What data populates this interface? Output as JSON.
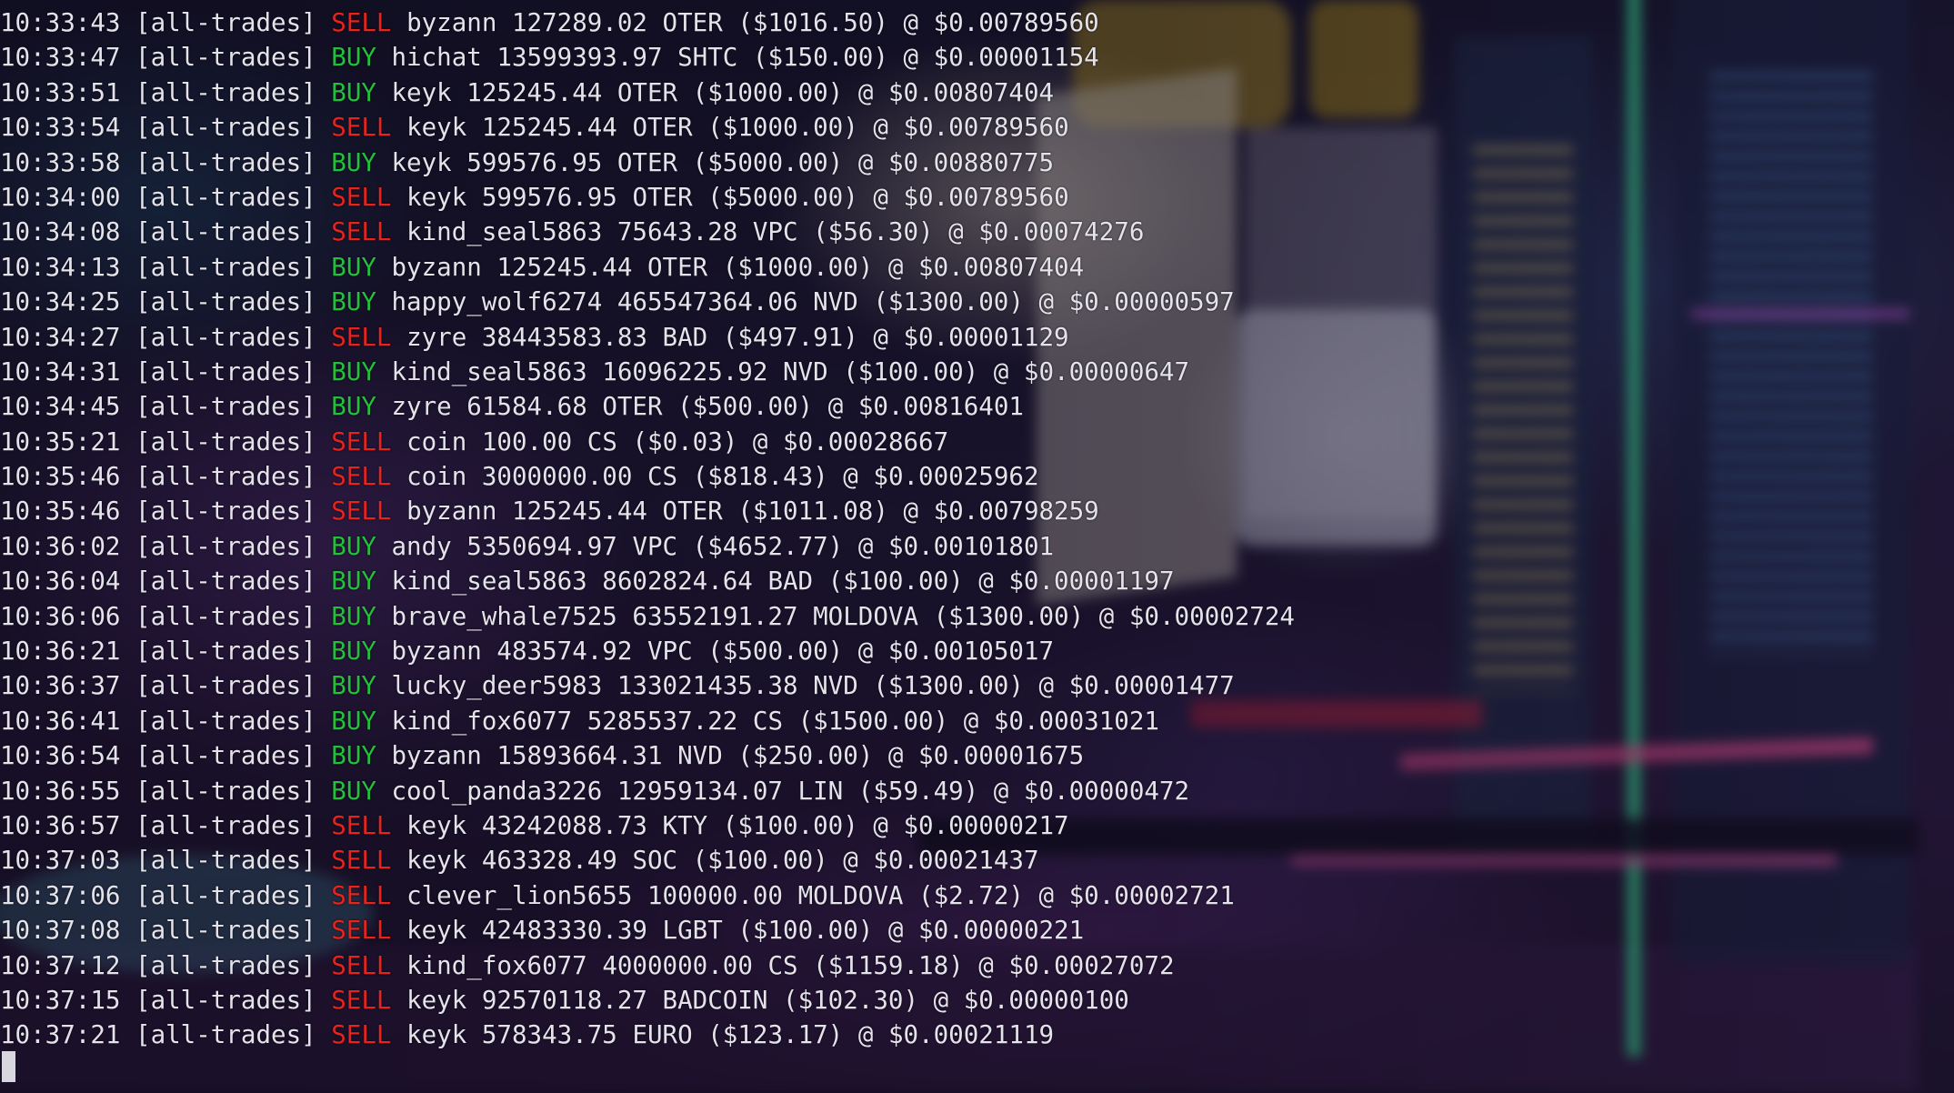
{
  "trades": [
    {
      "time": "10:33:43",
      "channel": "[all-trades]",
      "side": "SELL",
      "user": "byzann",
      "amount": "127289.02",
      "token": "OTER",
      "usd": "($1016.50)",
      "price": "$0.00789560"
    },
    {
      "time": "10:33:47",
      "channel": "[all-trades]",
      "side": "BUY",
      "user": "hichat",
      "amount": "13599393.97",
      "token": "SHTC",
      "usd": "($150.00)",
      "price": "$0.00001154"
    },
    {
      "time": "10:33:51",
      "channel": "[all-trades]",
      "side": "BUY",
      "user": "keyk",
      "amount": "125245.44",
      "token": "OTER",
      "usd": "($1000.00)",
      "price": "$0.00807404"
    },
    {
      "time": "10:33:54",
      "channel": "[all-trades]",
      "side": "SELL",
      "user": "keyk",
      "amount": "125245.44",
      "token": "OTER",
      "usd": "($1000.00)",
      "price": "$0.00789560"
    },
    {
      "time": "10:33:58",
      "channel": "[all-trades]",
      "side": "BUY",
      "user": "keyk",
      "amount": "599576.95",
      "token": "OTER",
      "usd": "($5000.00)",
      "price": "$0.00880775"
    },
    {
      "time": "10:34:00",
      "channel": "[all-trades]",
      "side": "SELL",
      "user": "keyk",
      "amount": "599576.95",
      "token": "OTER",
      "usd": "($5000.00)",
      "price": "$0.00789560"
    },
    {
      "time": "10:34:08",
      "channel": "[all-trades]",
      "side": "SELL",
      "user": "kind_seal5863",
      "amount": "75643.28",
      "token": "VPC",
      "usd": "($56.30)",
      "price": "$0.00074276"
    },
    {
      "time": "10:34:13",
      "channel": "[all-trades]",
      "side": "BUY",
      "user": "byzann",
      "amount": "125245.44",
      "token": "OTER",
      "usd": "($1000.00)",
      "price": "$0.00807404"
    },
    {
      "time": "10:34:25",
      "channel": "[all-trades]",
      "side": "BUY",
      "user": "happy_wolf6274",
      "amount": "465547364.06",
      "token": "NVD",
      "usd": "($1300.00)",
      "price": "$0.00000597"
    },
    {
      "time": "10:34:27",
      "channel": "[all-trades]",
      "side": "SELL",
      "user": "zyre",
      "amount": "38443583.83",
      "token": "BAD",
      "usd": "($497.91)",
      "price": "$0.00001129"
    },
    {
      "time": "10:34:31",
      "channel": "[all-trades]",
      "side": "BUY",
      "user": "kind_seal5863",
      "amount": "16096225.92",
      "token": "NVD",
      "usd": "($100.00)",
      "price": "$0.00000647"
    },
    {
      "time": "10:34:45",
      "channel": "[all-trades]",
      "side": "BUY",
      "user": "zyre",
      "amount": "61584.68",
      "token": "OTER",
      "usd": "($500.00)",
      "price": "$0.00816401"
    },
    {
      "time": "10:35:21",
      "channel": "[all-trades]",
      "side": "SELL",
      "user": "coin",
      "amount": "100.00",
      "token": "CS",
      "usd": "($0.03)",
      "price": "$0.00028667"
    },
    {
      "time": "10:35:46",
      "channel": "[all-trades]",
      "side": "SELL",
      "user": "coin",
      "amount": "3000000.00",
      "token": "CS",
      "usd": "($818.43)",
      "price": "$0.00025962"
    },
    {
      "time": "10:35:46",
      "channel": "[all-trades]",
      "side": "SELL",
      "user": "byzann",
      "amount": "125245.44",
      "token": "OTER",
      "usd": "($1011.08)",
      "price": "$0.00798259"
    },
    {
      "time": "10:36:02",
      "channel": "[all-trades]",
      "side": "BUY",
      "user": "andy",
      "amount": "5350694.97",
      "token": "VPC",
      "usd": "($4652.77)",
      "price": "$0.00101801"
    },
    {
      "time": "10:36:04",
      "channel": "[all-trades]",
      "side": "BUY",
      "user": "kind_seal5863",
      "amount": "8602824.64",
      "token": "BAD",
      "usd": "($100.00)",
      "price": "$0.00001197"
    },
    {
      "time": "10:36:06",
      "channel": "[all-trades]",
      "side": "BUY",
      "user": "brave_whale7525",
      "amount": "63552191.27",
      "token": "MOLDOVA",
      "usd": "($1300.00)",
      "price": "$0.00002724"
    },
    {
      "time": "10:36:21",
      "channel": "[all-trades]",
      "side": "BUY",
      "user": "byzann",
      "amount": "483574.92",
      "token": "VPC",
      "usd": "($500.00)",
      "price": "$0.00105017"
    },
    {
      "time": "10:36:37",
      "channel": "[all-trades]",
      "side": "BUY",
      "user": "lucky_deer5983",
      "amount": "133021435.38",
      "token": "NVD",
      "usd": "($1300.00)",
      "price": "$0.00001477"
    },
    {
      "time": "10:36:41",
      "channel": "[all-trades]",
      "side": "BUY",
      "user": "kind_fox6077",
      "amount": "5285537.22",
      "token": "CS",
      "usd": "($1500.00)",
      "price": "$0.00031021"
    },
    {
      "time": "10:36:54",
      "channel": "[all-trades]",
      "side": "BUY",
      "user": "byzann",
      "amount": "15893664.31",
      "token": "NVD",
      "usd": "($250.00)",
      "price": "$0.00001675"
    },
    {
      "time": "10:36:55",
      "channel": "[all-trades]",
      "side": "BUY",
      "user": "cool_panda3226",
      "amount": "12959134.07",
      "token": "LIN",
      "usd": "($59.49)",
      "price": "$0.00000472"
    },
    {
      "time": "10:36:57",
      "channel": "[all-trades]",
      "side": "SELL",
      "user": "keyk",
      "amount": "43242088.73",
      "token": "KTY",
      "usd": "($100.00)",
      "price": "$0.00000217"
    },
    {
      "time": "10:37:03",
      "channel": "[all-trades]",
      "side": "SELL",
      "user": "keyk",
      "amount": "463328.49",
      "token": "SOC",
      "usd": "($100.00)",
      "price": "$0.00021437"
    },
    {
      "time": "10:37:06",
      "channel": "[all-trades]",
      "side": "SELL",
      "user": "clever_lion5655",
      "amount": "100000.00",
      "token": "MOLDOVA",
      "usd": "($2.72)",
      "price": "$0.00002721"
    },
    {
      "time": "10:37:08",
      "channel": "[all-trades]",
      "side": "SELL",
      "user": "keyk",
      "amount": "42483330.39",
      "token": "LGBT",
      "usd": "($100.00)",
      "price": "$0.00000221"
    },
    {
      "time": "10:37:12",
      "channel": "[all-trades]",
      "side": "SELL",
      "user": "kind_fox6077",
      "amount": "4000000.00",
      "token": "CS",
      "usd": "($1159.18)",
      "price": "$0.00027072"
    },
    {
      "time": "10:37:15",
      "channel": "[all-trades]",
      "side": "SELL",
      "user": "keyk",
      "amount": "92570118.27",
      "token": "BADCOIN",
      "usd": "($102.30)",
      "price": "$0.00000100"
    },
    {
      "time": "10:37:21",
      "channel": "[all-trades]",
      "side": "SELL",
      "user": "keyk",
      "amount": "578343.75",
      "token": "EURO",
      "usd": "($123.17)",
      "price": "$0.00021119"
    }
  ],
  "separator_at": "@",
  "colors": {
    "buy": "#23c13b",
    "sell": "#e8231e",
    "text": "#e4e2ea"
  }
}
